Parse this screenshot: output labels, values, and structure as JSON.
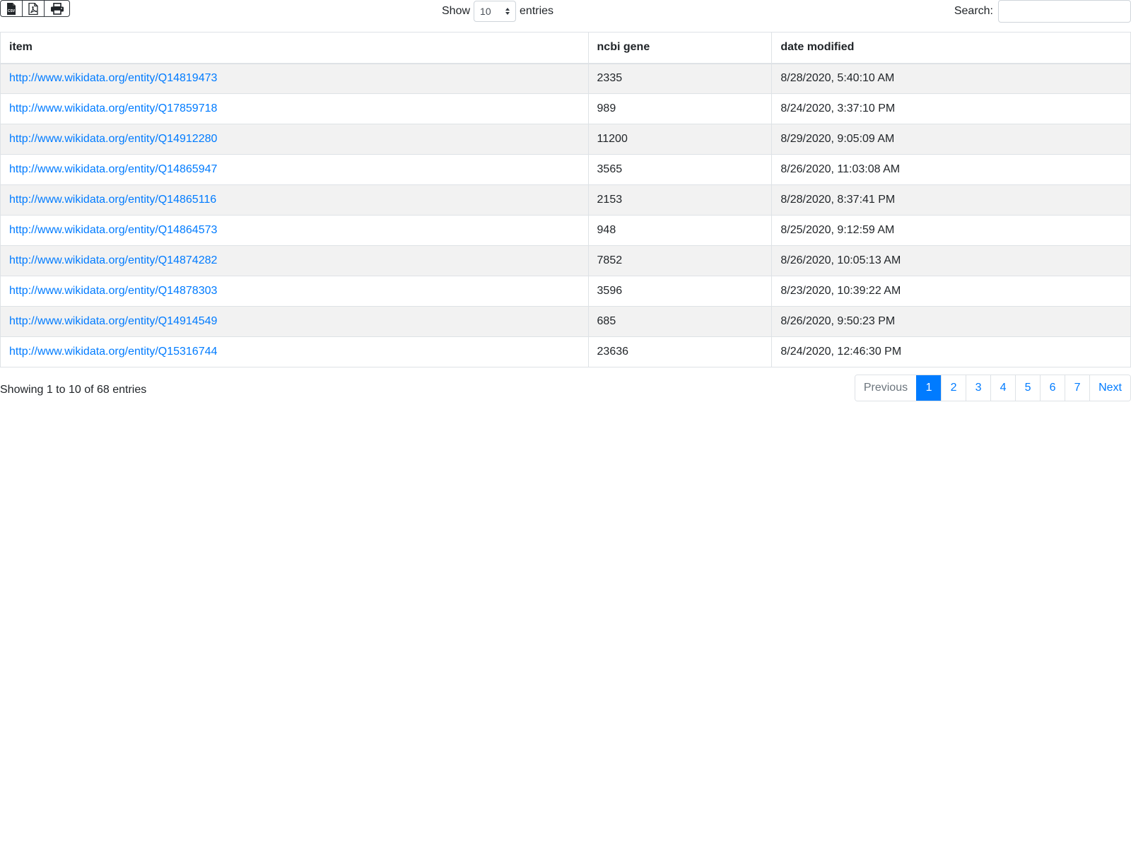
{
  "toolbar": {
    "export_buttons": [
      {
        "name": "csv",
        "icon": "csv-file-icon",
        "icon_text": "CSV"
      },
      {
        "name": "pdf",
        "icon": "pdf-file-icon"
      },
      {
        "name": "print",
        "icon": "print-icon"
      }
    ],
    "length": {
      "show_label": "Show",
      "selected": "10",
      "entries_label": "entries"
    },
    "search": {
      "label": "Search:",
      "value": "",
      "placeholder": ""
    }
  },
  "table": {
    "columns": [
      "item",
      "ncbi gene",
      "date modified"
    ],
    "rows": [
      {
        "item": "http://www.wikidata.org/entity/Q14819473",
        "gene": "2335",
        "date": "8/28/2020, 5:40:10 AM"
      },
      {
        "item": "http://www.wikidata.org/entity/Q17859718",
        "gene": "989",
        "date": "8/24/2020, 3:37:10 PM"
      },
      {
        "item": "http://www.wikidata.org/entity/Q14912280",
        "gene": "11200",
        "date": "8/29/2020, 9:05:09 AM"
      },
      {
        "item": "http://www.wikidata.org/entity/Q14865947",
        "gene": "3565",
        "date": "8/26/2020, 11:03:08 AM"
      },
      {
        "item": "http://www.wikidata.org/entity/Q14865116",
        "gene": "2153",
        "date": "8/28/2020, 8:37:41 PM"
      },
      {
        "item": "http://www.wikidata.org/entity/Q14864573",
        "gene": "948",
        "date": "8/25/2020, 9:12:59 AM"
      },
      {
        "item": "http://www.wikidata.org/entity/Q14874282",
        "gene": "7852",
        "date": "8/26/2020, 10:05:13 AM"
      },
      {
        "item": "http://www.wikidata.org/entity/Q14878303",
        "gene": "3596",
        "date": "8/23/2020, 10:39:22 AM"
      },
      {
        "item": "http://www.wikidata.org/entity/Q14914549",
        "gene": "685",
        "date": "8/26/2020, 9:50:23 PM"
      },
      {
        "item": "http://www.wikidata.org/entity/Q15316744",
        "gene": "23636",
        "date": "8/24/2020, 12:46:30 PM"
      }
    ]
  },
  "footer": {
    "info": "Showing 1 to 10 of 68 entries",
    "pagination": {
      "previous": "Previous",
      "next": "Next",
      "pages": [
        "1",
        "2",
        "3",
        "4",
        "5",
        "6",
        "7"
      ],
      "current": "1"
    }
  },
  "colors": {
    "link": "#007bff",
    "active_page_bg": "#007bff",
    "stripe": "#f2f2f2",
    "border": "#dee2e6"
  }
}
